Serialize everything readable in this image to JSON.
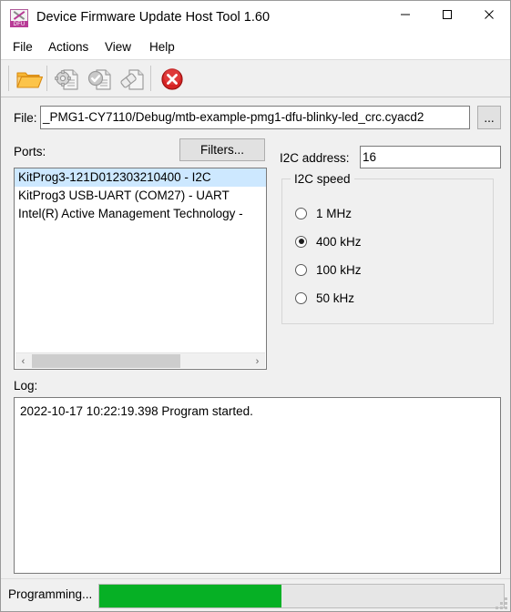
{
  "window": {
    "title": "Device Firmware Update Host Tool 1.60",
    "app_icon": "dfu-app-icon",
    "icon_text": "DFU",
    "minimize_label": "—",
    "maximize_label": "□",
    "close_label": "✕"
  },
  "menu": {
    "items": [
      {
        "label": "File"
      },
      {
        "label": "Actions"
      },
      {
        "label": "View"
      },
      {
        "label": "Help"
      }
    ]
  },
  "toolbar": {
    "buttons": [
      {
        "name": "open-file-icon",
        "enabled": true
      },
      {
        "name": "program-document-icon",
        "enabled": false
      },
      {
        "name": "verify-document-icon",
        "enabled": false
      },
      {
        "name": "erase-document-icon",
        "enabled": false
      },
      {
        "name": "abort-icon",
        "enabled": true
      }
    ]
  },
  "file_row": {
    "label": "File:",
    "path": "_PMG1-CY7110/Debug/mtb-example-pmg1-dfu-blinky-led_crc.cyacd2",
    "browse_label": "..."
  },
  "ports": {
    "label": "Ports:",
    "filters_label": "Filters...",
    "items": [
      {
        "label": "KitProg3-121D012303210400 - I2C",
        "selected": true
      },
      {
        "label": "KitProg3 USB-UART (COM27) - UART",
        "selected": false
      },
      {
        "label": "Intel(R) Active Management Technology -",
        "selected": false
      }
    ],
    "scroll_left_icon": "‹",
    "scroll_right_icon": "›"
  },
  "i2c": {
    "address_label": "I2C address:",
    "address_value": "16",
    "speed_group_label": "I2C speed",
    "speed_options": [
      {
        "label": "1 MHz",
        "selected": false
      },
      {
        "label": "400 kHz",
        "selected": true
      },
      {
        "label": "100 kHz",
        "selected": false
      },
      {
        "label": "50 kHz",
        "selected": false
      }
    ]
  },
  "log": {
    "label": "Log:",
    "lines": [
      "2022-10-17 10:22:19.398 Program started."
    ]
  },
  "status": {
    "text": "Programming...",
    "progress_percent": 45
  },
  "colors": {
    "accent_progress": "#06b025",
    "selection": "#cde8ff",
    "app_icon": "#b83b96",
    "abort_red": "#d62424",
    "folder_orange": "#f2a41a"
  }
}
